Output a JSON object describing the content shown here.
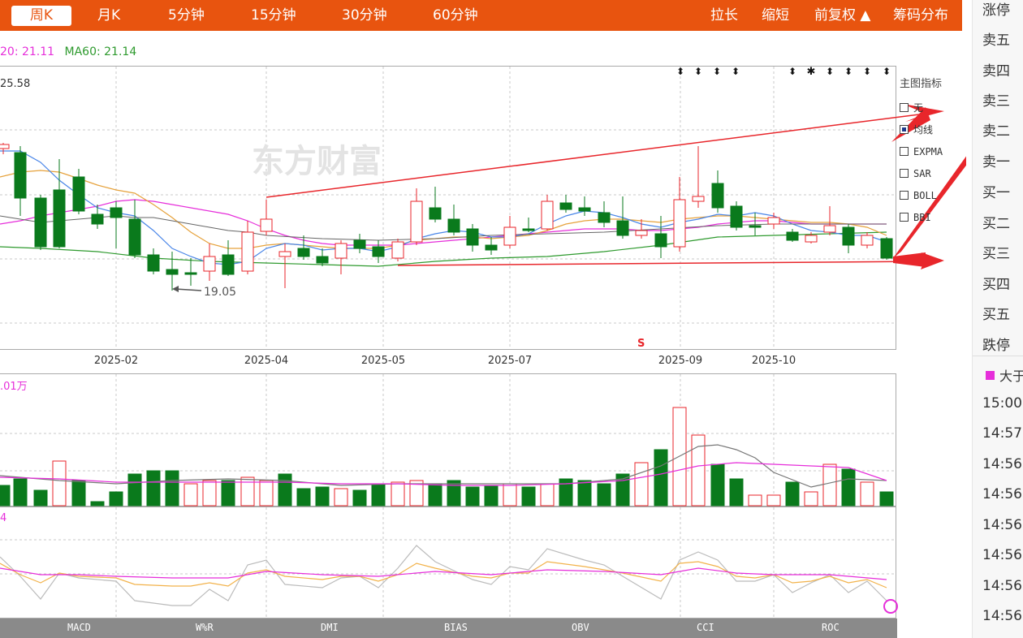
{
  "toolbar": {
    "tabs": [
      "周K",
      "月K",
      "5分钟",
      "15分钟",
      "30分钟",
      "60分钟"
    ],
    "right_actions": [
      "拉长",
      "缩短",
      "前复权 ▲",
      "筹码分布"
    ]
  },
  "ma_legend": {
    "ma20": "20: 21.11",
    "ma60": "MA60: 21.14"
  },
  "main_chart": {
    "high_label": "25.58",
    "low_label": "19.05",
    "watermark": "东方财富",
    "s_marker": "S",
    "x_ticks": [
      "2025-02",
      "2025-04",
      "2025-05",
      "2025-07",
      "2025-09",
      "2025-10"
    ]
  },
  "indicator_panel": {
    "title": "主图指标",
    "items": [
      {
        "label": "无",
        "checked": false
      },
      {
        "label": "均线",
        "checked": true
      },
      {
        "label": "EXPMA",
        "checked": false
      },
      {
        "label": "SAR",
        "checked": false
      },
      {
        "label": "BOLL",
        "checked": false
      },
      {
        "label": "BBI",
        "checked": false
      }
    ]
  },
  "volume_chart": {
    "label": ".01万"
  },
  "lower_chart": {
    "label": "4"
  },
  "bottom_tabs": [
    "MACD",
    "W%R",
    "DMI",
    "BIAS",
    "OBV",
    "CCI",
    "ROC"
  ],
  "right_panel": {
    "order_book": [
      "涨停",
      "卖五",
      "卖四",
      "卖三",
      "卖二",
      "卖一",
      "买一",
      "买二",
      "买三",
      "买四",
      "买五",
      "跌停"
    ],
    "big_order_label": "大于",
    "times": [
      "15:00:",
      "14:57:",
      "14:56:",
      "14:56:",
      "14:56:",
      "14:56:",
      "14:56:",
      "14:56:"
    ]
  },
  "colors": {
    "accent": "#e8540f",
    "up": "#e8262b",
    "down": "#0a7a1c",
    "ma5": "#4a86e8",
    "ma10": "#e6a23c",
    "ma20": "#e62eda",
    "ma60": "#2e9a2e"
  }
}
